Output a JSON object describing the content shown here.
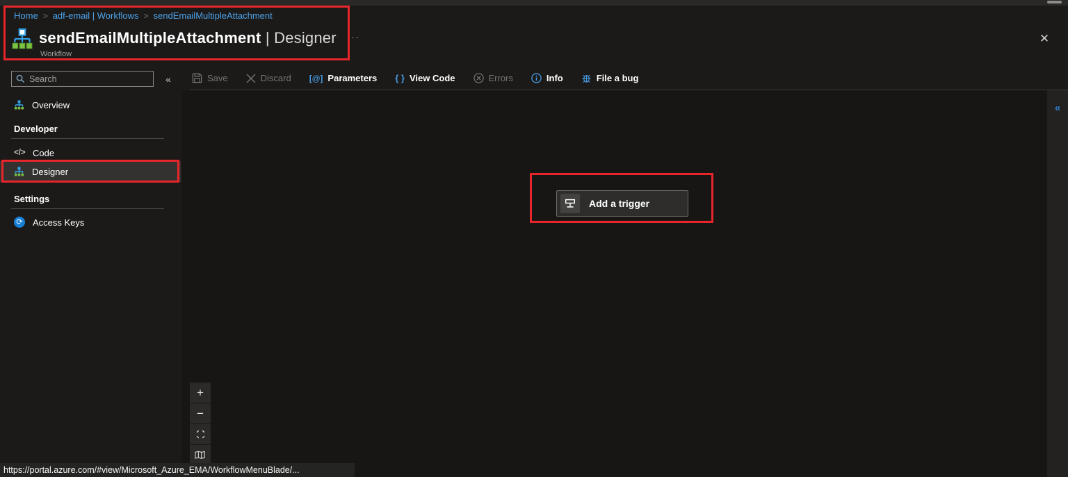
{
  "page": {
    "breadcrumb": [
      "Home",
      "adf-email | Workflows",
      "sendEmailMultipleAttachment"
    ],
    "breadcrumb_sep": ">",
    "title": "sendEmailMultipleAttachment",
    "title_suffix": " | Designer",
    "subtitle": "Workflow",
    "ellipsis": "···",
    "close_glyph": "✕"
  },
  "sidebar": {
    "search_placeholder": "Search",
    "collapse_glyph": "«",
    "overview_label": "Overview",
    "sections": [
      {
        "label": "Developer"
      },
      {
        "label": "Settings"
      }
    ],
    "code_label": "Code",
    "code_icon_glyph": "</>",
    "designer_label": "Designer",
    "access_keys_label": "Access Keys",
    "access_keys_icon_glyph": "⟳"
  },
  "toolbar": {
    "items": [
      {
        "label": "Save",
        "disabled": true
      },
      {
        "label": "Discard",
        "disabled": true
      },
      {
        "label": "Parameters",
        "disabled": false
      },
      {
        "label": "View Code",
        "disabled": false
      },
      {
        "label": "Errors",
        "disabled": true
      },
      {
        "label": "Info",
        "disabled": false
      },
      {
        "label": "File a bug",
        "disabled": false
      }
    ],
    "parameters_icon_glyph": "[@]",
    "view_code_icon_glyph": "{ }"
  },
  "canvas": {
    "add_trigger_label": "Add a trigger",
    "zoom_in_glyph": "+",
    "zoom_out_glyph": "−"
  },
  "right_panel": {
    "collapse_glyph": "«"
  },
  "status_bar": {
    "url": "https://portal.azure.com/#view/Microsoft_Azure_EMA/WorkflowMenuBlade/..."
  },
  "colors": {
    "accent_blue": "#4da2e8",
    "annotation_red": "#e7252b",
    "workflow_icon_blue": "#35a3e8",
    "workflow_icon_green": "#7cc142",
    "access_keys_blue": "#1881d6"
  }
}
